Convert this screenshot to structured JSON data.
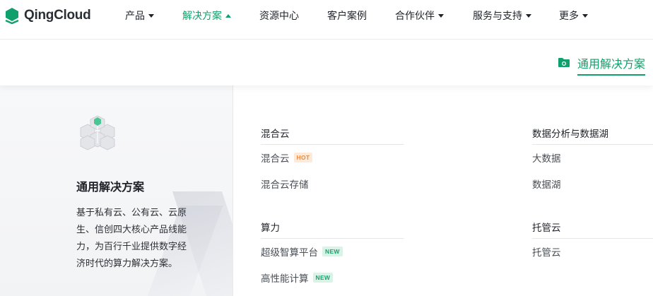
{
  "brand": {
    "name": "QingCloud",
    "color": "#0fa06c"
  },
  "nav": {
    "items": [
      {
        "label": "产品",
        "caret": "down",
        "active": false
      },
      {
        "label": "解决方案",
        "caret": "up",
        "active": true
      },
      {
        "label": "资源中心",
        "caret": "none",
        "active": false
      },
      {
        "label": "客户案例",
        "caret": "none",
        "active": false
      },
      {
        "label": "合作伙伴",
        "caret": "down",
        "active": false
      },
      {
        "label": "服务与支持",
        "caret": "down",
        "active": false
      },
      {
        "label": "更多",
        "caret": "down",
        "active": false
      }
    ]
  },
  "subheader": {
    "tab_label": "通用解决方案",
    "tab_icon": "folder-icon"
  },
  "panel": {
    "title": "通用解决方案",
    "description": "基于私有云、公有云、云原生、信创四大核心产品线能力，为百行千业提供数字经济时代的算力解决方案。",
    "icon": "cube-cluster-icon"
  },
  "columns": [
    {
      "groups": [
        {
          "heading": "混合云",
          "links": [
            {
              "label": "混合云",
              "badge": "HOT"
            },
            {
              "label": "混合云存储",
              "badge": ""
            }
          ]
        },
        {
          "heading": "算力",
          "links": [
            {
              "label": "超级智算平台",
              "badge": "NEW"
            },
            {
              "label": "高性能计算",
              "badge": "NEW"
            }
          ]
        }
      ]
    },
    {
      "groups": [
        {
          "heading": "数据分析与数据湖",
          "links": [
            {
              "label": "大数据",
              "badge": ""
            },
            {
              "label": "数据湖",
              "badge": ""
            }
          ]
        },
        {
          "heading": "托管云",
          "links": [
            {
              "label": "托管云",
              "badge": ""
            }
          ]
        }
      ]
    }
  ]
}
